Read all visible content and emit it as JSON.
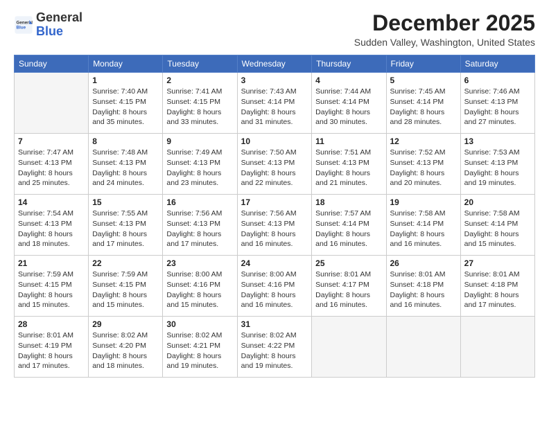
{
  "header": {
    "logo_general": "General",
    "logo_blue": "Blue",
    "month_title": "December 2025",
    "location": "Sudden Valley, Washington, United States"
  },
  "weekdays": [
    "Sunday",
    "Monday",
    "Tuesday",
    "Wednesday",
    "Thursday",
    "Friday",
    "Saturday"
  ],
  "weeks": [
    [
      {
        "day": "",
        "sunrise": "",
        "sunset": "",
        "daylight": ""
      },
      {
        "day": "1",
        "sunrise": "Sunrise: 7:40 AM",
        "sunset": "Sunset: 4:15 PM",
        "daylight": "Daylight: 8 hours and 35 minutes."
      },
      {
        "day": "2",
        "sunrise": "Sunrise: 7:41 AM",
        "sunset": "Sunset: 4:15 PM",
        "daylight": "Daylight: 8 hours and 33 minutes."
      },
      {
        "day": "3",
        "sunrise": "Sunrise: 7:43 AM",
        "sunset": "Sunset: 4:14 PM",
        "daylight": "Daylight: 8 hours and 31 minutes."
      },
      {
        "day": "4",
        "sunrise": "Sunrise: 7:44 AM",
        "sunset": "Sunset: 4:14 PM",
        "daylight": "Daylight: 8 hours and 30 minutes."
      },
      {
        "day": "5",
        "sunrise": "Sunrise: 7:45 AM",
        "sunset": "Sunset: 4:14 PM",
        "daylight": "Daylight: 8 hours and 28 minutes."
      },
      {
        "day": "6",
        "sunrise": "Sunrise: 7:46 AM",
        "sunset": "Sunset: 4:13 PM",
        "daylight": "Daylight: 8 hours and 27 minutes."
      }
    ],
    [
      {
        "day": "7",
        "sunrise": "Sunrise: 7:47 AM",
        "sunset": "Sunset: 4:13 PM",
        "daylight": "Daylight: 8 hours and 25 minutes."
      },
      {
        "day": "8",
        "sunrise": "Sunrise: 7:48 AM",
        "sunset": "Sunset: 4:13 PM",
        "daylight": "Daylight: 8 hours and 24 minutes."
      },
      {
        "day": "9",
        "sunrise": "Sunrise: 7:49 AM",
        "sunset": "Sunset: 4:13 PM",
        "daylight": "Daylight: 8 hours and 23 minutes."
      },
      {
        "day": "10",
        "sunrise": "Sunrise: 7:50 AM",
        "sunset": "Sunset: 4:13 PM",
        "daylight": "Daylight: 8 hours and 22 minutes."
      },
      {
        "day": "11",
        "sunrise": "Sunrise: 7:51 AM",
        "sunset": "Sunset: 4:13 PM",
        "daylight": "Daylight: 8 hours and 21 minutes."
      },
      {
        "day": "12",
        "sunrise": "Sunrise: 7:52 AM",
        "sunset": "Sunset: 4:13 PM",
        "daylight": "Daylight: 8 hours and 20 minutes."
      },
      {
        "day": "13",
        "sunrise": "Sunrise: 7:53 AM",
        "sunset": "Sunset: 4:13 PM",
        "daylight": "Daylight: 8 hours and 19 minutes."
      }
    ],
    [
      {
        "day": "14",
        "sunrise": "Sunrise: 7:54 AM",
        "sunset": "Sunset: 4:13 PM",
        "daylight": "Daylight: 8 hours and 18 minutes."
      },
      {
        "day": "15",
        "sunrise": "Sunrise: 7:55 AM",
        "sunset": "Sunset: 4:13 PM",
        "daylight": "Daylight: 8 hours and 17 minutes."
      },
      {
        "day": "16",
        "sunrise": "Sunrise: 7:56 AM",
        "sunset": "Sunset: 4:13 PM",
        "daylight": "Daylight: 8 hours and 17 minutes."
      },
      {
        "day": "17",
        "sunrise": "Sunrise: 7:56 AM",
        "sunset": "Sunset: 4:13 PM",
        "daylight": "Daylight: 8 hours and 16 minutes."
      },
      {
        "day": "18",
        "sunrise": "Sunrise: 7:57 AM",
        "sunset": "Sunset: 4:14 PM",
        "daylight": "Daylight: 8 hours and 16 minutes."
      },
      {
        "day": "19",
        "sunrise": "Sunrise: 7:58 AM",
        "sunset": "Sunset: 4:14 PM",
        "daylight": "Daylight: 8 hours and 16 minutes."
      },
      {
        "day": "20",
        "sunrise": "Sunrise: 7:58 AM",
        "sunset": "Sunset: 4:14 PM",
        "daylight": "Daylight: 8 hours and 15 minutes."
      }
    ],
    [
      {
        "day": "21",
        "sunrise": "Sunrise: 7:59 AM",
        "sunset": "Sunset: 4:15 PM",
        "daylight": "Daylight: 8 hours and 15 minutes."
      },
      {
        "day": "22",
        "sunrise": "Sunrise: 7:59 AM",
        "sunset": "Sunset: 4:15 PM",
        "daylight": "Daylight: 8 hours and 15 minutes."
      },
      {
        "day": "23",
        "sunrise": "Sunrise: 8:00 AM",
        "sunset": "Sunset: 4:16 PM",
        "daylight": "Daylight: 8 hours and 15 minutes."
      },
      {
        "day": "24",
        "sunrise": "Sunrise: 8:00 AM",
        "sunset": "Sunset: 4:16 PM",
        "daylight": "Daylight: 8 hours and 16 minutes."
      },
      {
        "day": "25",
        "sunrise": "Sunrise: 8:01 AM",
        "sunset": "Sunset: 4:17 PM",
        "daylight": "Daylight: 8 hours and 16 minutes."
      },
      {
        "day": "26",
        "sunrise": "Sunrise: 8:01 AM",
        "sunset": "Sunset: 4:18 PM",
        "daylight": "Daylight: 8 hours and 16 minutes."
      },
      {
        "day": "27",
        "sunrise": "Sunrise: 8:01 AM",
        "sunset": "Sunset: 4:18 PM",
        "daylight": "Daylight: 8 hours and 17 minutes."
      }
    ],
    [
      {
        "day": "28",
        "sunrise": "Sunrise: 8:01 AM",
        "sunset": "Sunset: 4:19 PM",
        "daylight": "Daylight: 8 hours and 17 minutes."
      },
      {
        "day": "29",
        "sunrise": "Sunrise: 8:02 AM",
        "sunset": "Sunset: 4:20 PM",
        "daylight": "Daylight: 8 hours and 18 minutes."
      },
      {
        "day": "30",
        "sunrise": "Sunrise: 8:02 AM",
        "sunset": "Sunset: 4:21 PM",
        "daylight": "Daylight: 8 hours and 19 minutes."
      },
      {
        "day": "31",
        "sunrise": "Sunrise: 8:02 AM",
        "sunset": "Sunset: 4:22 PM",
        "daylight": "Daylight: 8 hours and 19 minutes."
      },
      {
        "day": "",
        "sunrise": "",
        "sunset": "",
        "daylight": ""
      },
      {
        "day": "",
        "sunrise": "",
        "sunset": "",
        "daylight": ""
      },
      {
        "day": "",
        "sunrise": "",
        "sunset": "",
        "daylight": ""
      }
    ]
  ]
}
